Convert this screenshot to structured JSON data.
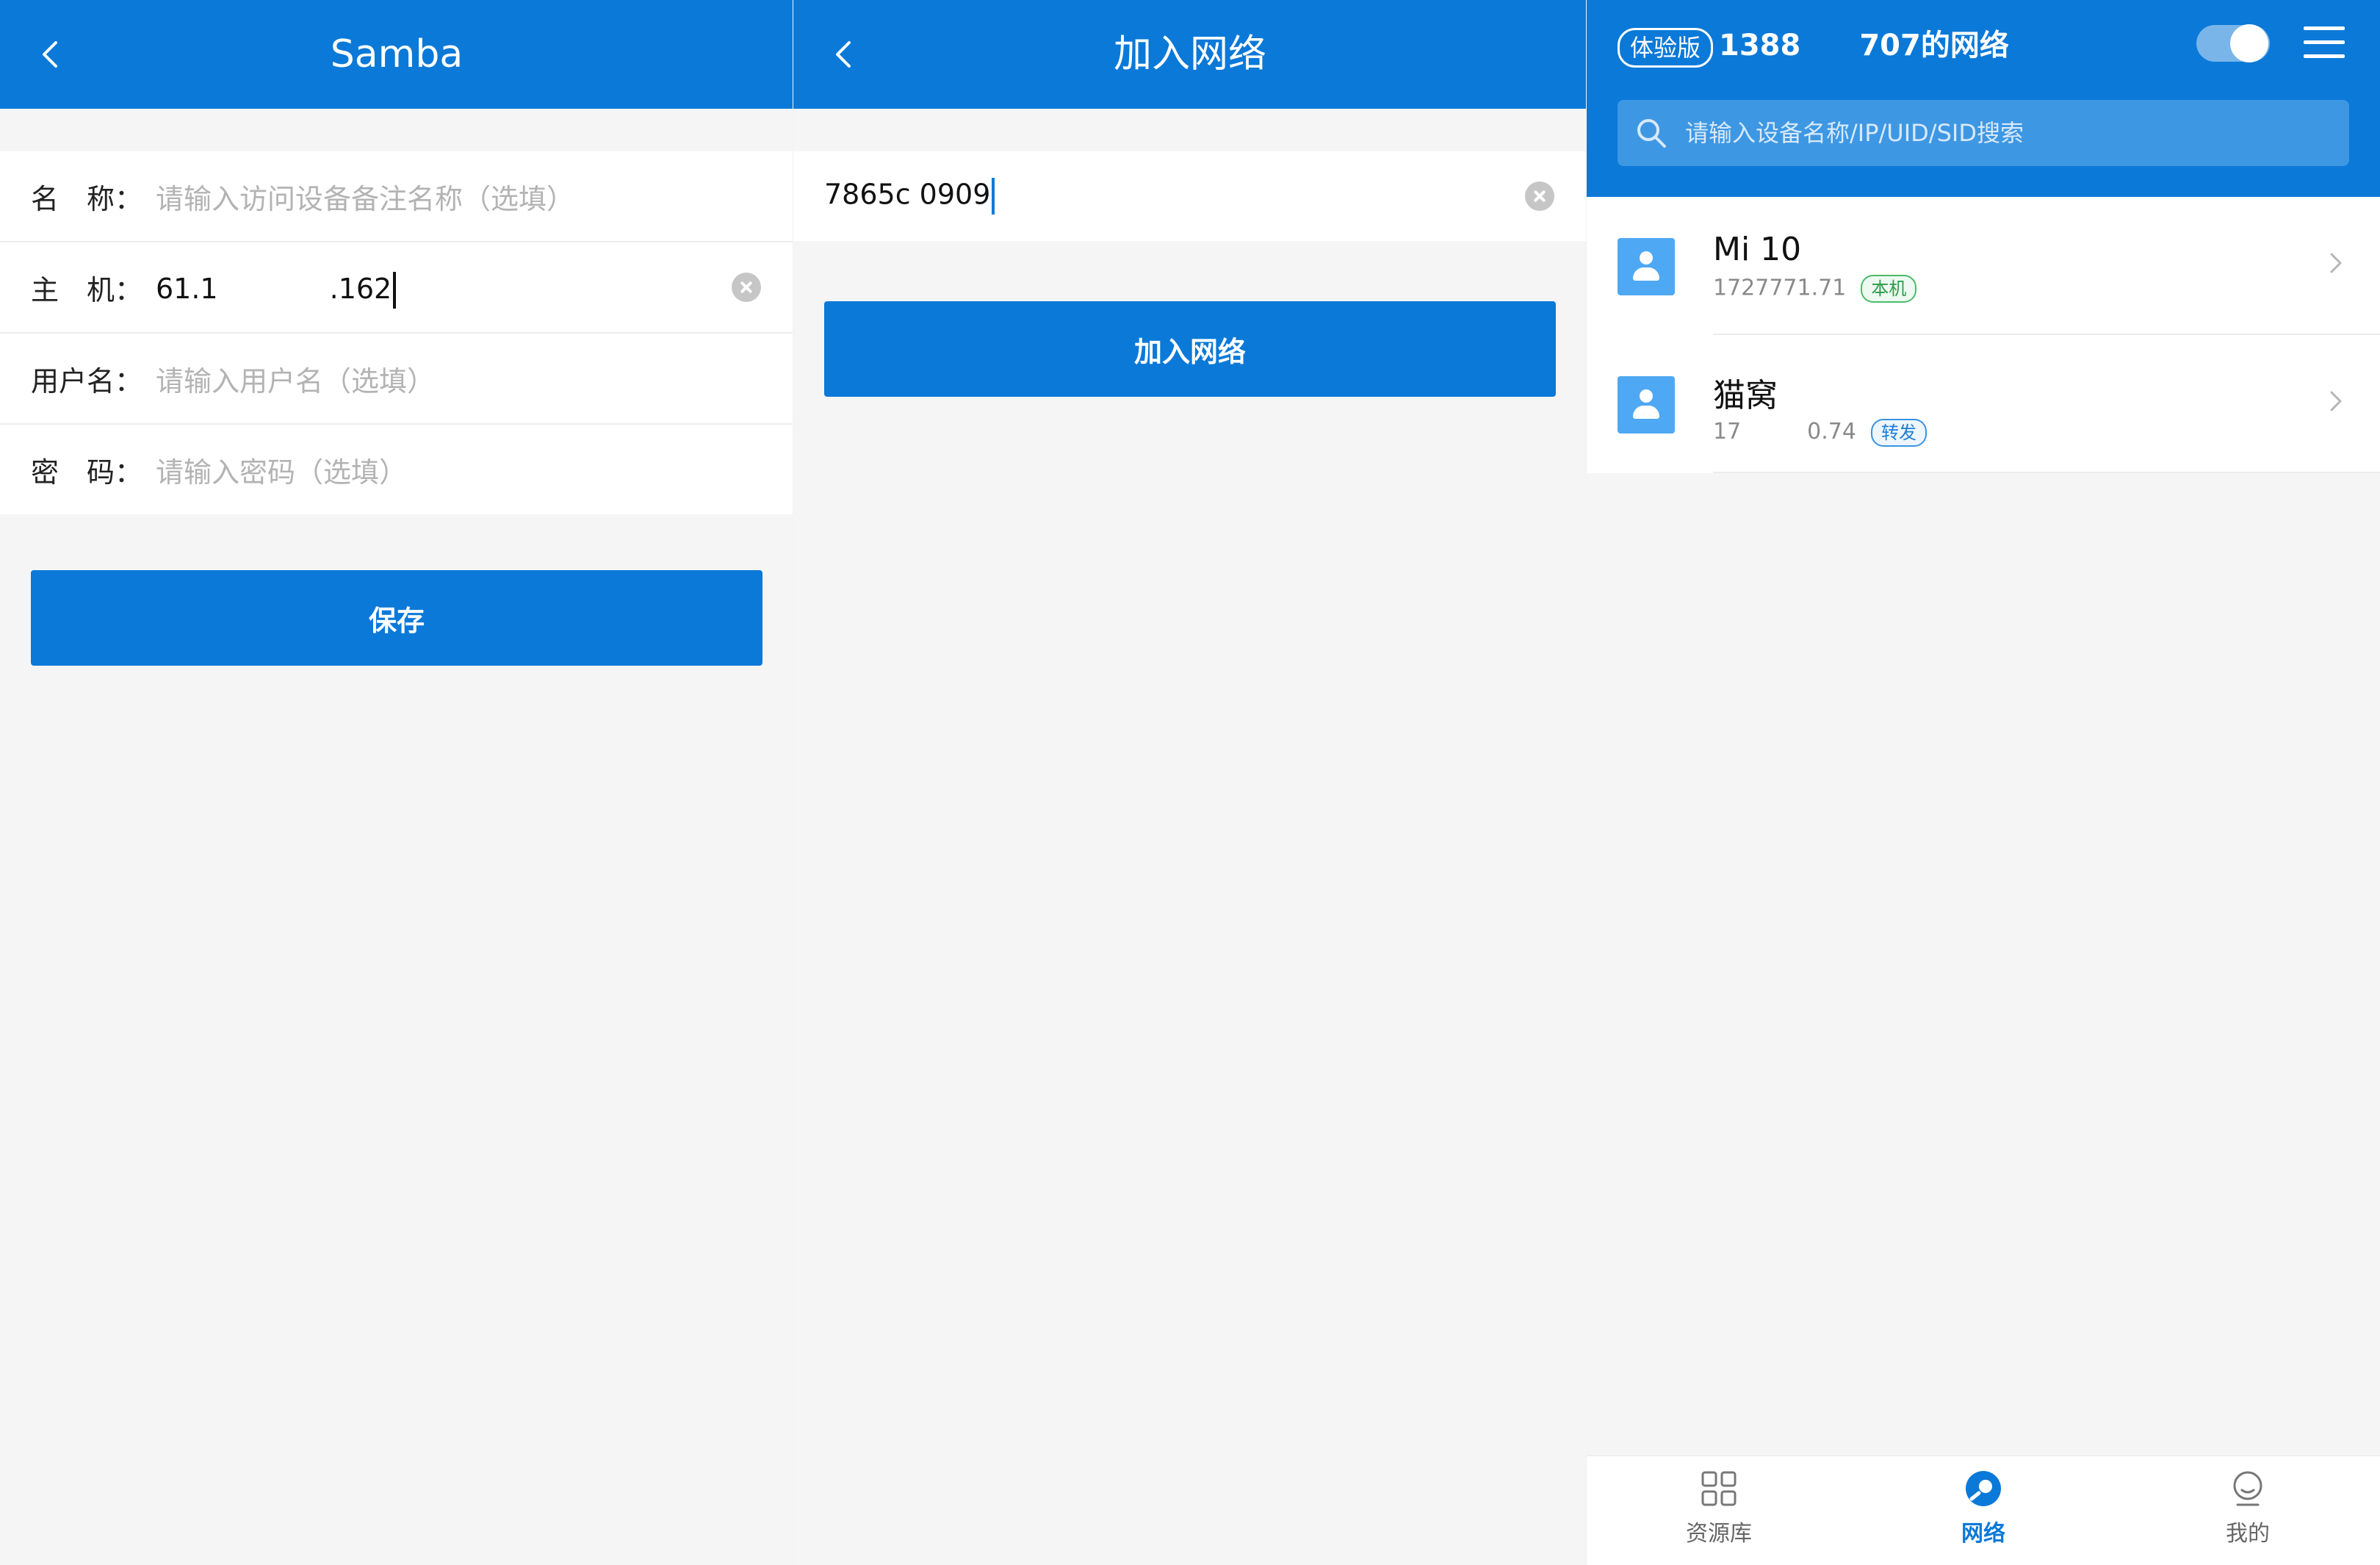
{
  "samba": {
    "title": "Samba",
    "fields": [
      {
        "label": "名　称：",
        "placeholder": "请输入访问设备备注名称（选填）",
        "value": ""
      },
      {
        "label": "主　机：",
        "placeholder": "",
        "value": "61.1　　　　.162"
      },
      {
        "label": "用户名：",
        "placeholder": "请输入用户名（选填）",
        "value": ""
      },
      {
        "label": "密　码：",
        "placeholder": "请输入密码（选填）",
        "value": ""
      }
    ],
    "save_label": "保存"
  },
  "join": {
    "title": "加入网络",
    "input_value": "7865c 0909",
    "join_label": "加入网络"
  },
  "network": {
    "trial_badge": "体验版",
    "title": "1388　　707的网络",
    "toggle_on": true,
    "search_placeholder": "请输入设备名称/IP/UID/SID搜索",
    "devices": [
      {
        "name": "Mi 10",
        "ip": "1727771.71",
        "tag": "本机",
        "tag_color": "#4cbb6a"
      },
      {
        "name": "猫窝",
        "ip": "17　　　0.74",
        "tag": "转发",
        "tag_color": "#3a93e0"
      }
    ],
    "nav": [
      {
        "label": "资源库",
        "icon": "grid-icon",
        "active": false
      },
      {
        "label": "网络",
        "icon": "network-icon",
        "active": true
      },
      {
        "label": "我的",
        "icon": "profile-icon",
        "active": false
      }
    ]
  },
  "colors": {
    "brand": "#0b79d8",
    "background": "#f5f5f5"
  }
}
